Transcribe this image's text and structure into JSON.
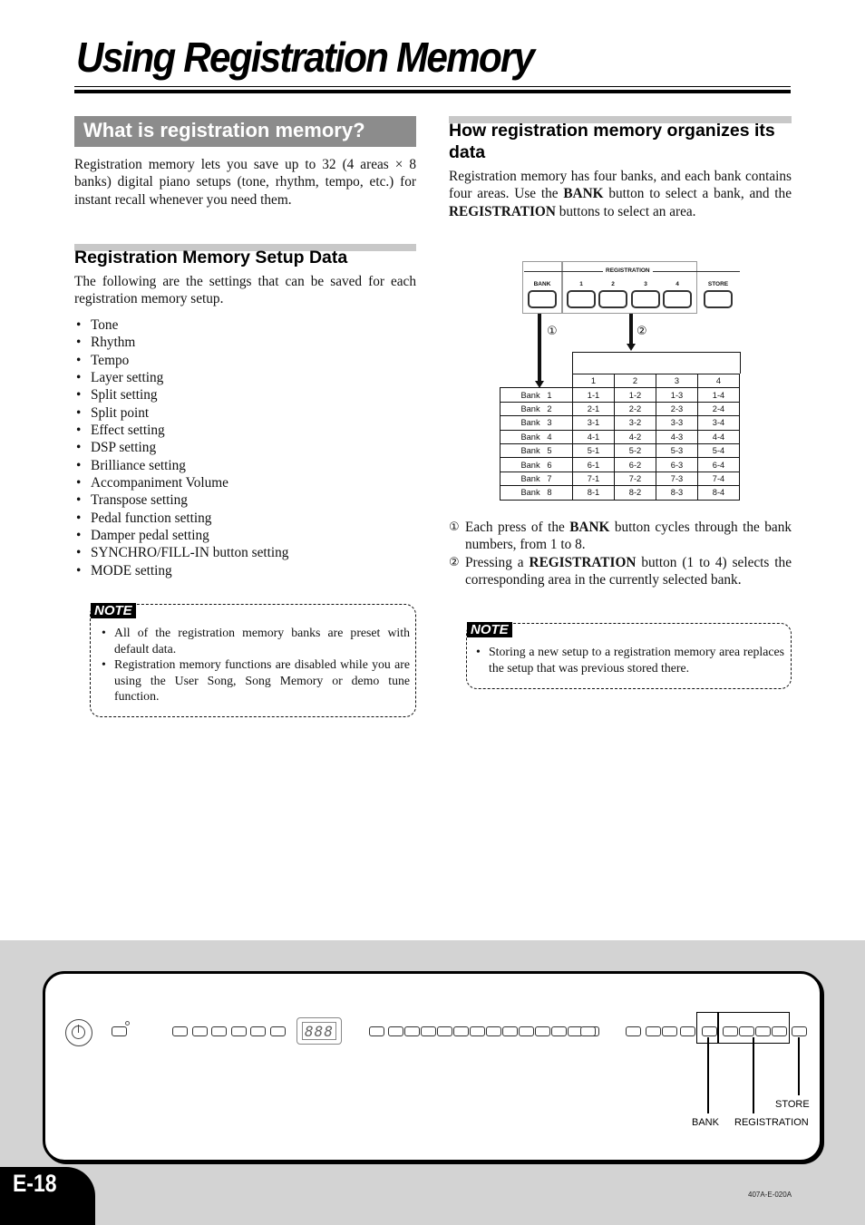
{
  "page_title": "Using Registration Memory",
  "left": {
    "section1_heading": "What is registration memory?",
    "section1_text": "Registration memory lets you save up to 32 (4 areas × 8 banks) digital piano setups (tone, rhythm, tempo, etc.) for instant recall whenever you need them.",
    "section2_heading": "Registration Memory Setup Data",
    "section2_intro": "The following are the settings that can be saved for each registration memory setup.",
    "settings": [
      "Tone",
      "Rhythm",
      "Tempo",
      "Layer setting",
      "Split setting",
      "Split point",
      "Effect setting",
      "DSP setting",
      "Brilliance setting",
      "Accompaniment Volume",
      "Transpose setting",
      "Pedal function setting",
      "Damper pedal setting",
      "SYNCHRO/FILL-IN button setting",
      "MODE setting"
    ],
    "note": {
      "tag": "NOTE",
      "items": [
        "All of the registration memory banks are preset with default data.",
        "Registration memory functions are disabled while you are using the User Song, Song Memory or demo tune function."
      ]
    }
  },
  "right": {
    "heading": "How registration memory organizes its data",
    "intro_pre": "Registration memory has four banks, and each bank contains four areas. Use the ",
    "intro_bank": "BANK",
    "intro_mid": " button to select a bank, and the ",
    "intro_reg": "REGISTRATION",
    "intro_post": " buttons to select an area.",
    "diagram": {
      "bank_label": "BANK",
      "registration_label": "REGISTRATION",
      "store_label": "STORE",
      "reg_buttons": [
        "1",
        "2",
        "3",
        "4"
      ],
      "marker1": "①",
      "marker2": "②",
      "table": {
        "columns": [
          "1",
          "2",
          "3",
          "4"
        ],
        "rows": [
          {
            "bank": "Bank   1",
            "cells": [
              "1-1",
              "1-2",
              "1-3",
              "1-4"
            ]
          },
          {
            "bank": "Bank   2",
            "cells": [
              "2-1",
              "2-2",
              "2-3",
              "2-4"
            ]
          },
          {
            "bank": "Bank   3",
            "cells": [
              "3-1",
              "3-2",
              "3-3",
              "3-4"
            ]
          },
          {
            "bank": "Bank   4",
            "cells": [
              "4-1",
              "4-2",
              "4-3",
              "4-4"
            ]
          },
          {
            "bank": "Bank   5",
            "cells": [
              "5-1",
              "5-2",
              "5-3",
              "5-4"
            ]
          },
          {
            "bank": "Bank   6",
            "cells": [
              "6-1",
              "6-2",
              "6-3",
              "6-4"
            ]
          },
          {
            "bank": "Bank   7",
            "cells": [
              "7-1",
              "7-2",
              "7-3",
              "7-4"
            ]
          },
          {
            "bank": "Bank   8",
            "cells": [
              "8-1",
              "8-2",
              "8-3",
              "8-4"
            ]
          }
        ]
      }
    },
    "step1": {
      "marker": "①",
      "pre": "Each press of the ",
      "bold": "BANK",
      "post": " button cycles through the bank numbers, from 1 to 8."
    },
    "step2": {
      "marker": "②",
      "pre": "Pressing a ",
      "bold": "REGISTRATION",
      "post": " button (1 to 4) selects the corresponding area in the currently selected bank."
    },
    "note": {
      "tag": "NOTE",
      "items": [
        "Storing a new setup to a registration memory area replaces the setup that was previous stored there."
      ]
    }
  },
  "panel": {
    "display": "888",
    "callouts": {
      "bank": "BANK",
      "registration": "REGISTRATION",
      "store": "STORE"
    }
  },
  "footer": {
    "page_number": "E-18",
    "code": "407A-E-020A"
  }
}
